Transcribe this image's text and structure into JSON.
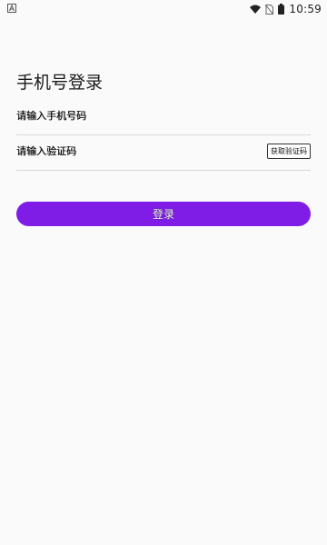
{
  "status_bar": {
    "time": "10:59",
    "icons": [
      "notification-a-icon",
      "wifi-icon",
      "no-sim-icon",
      "battery-icon"
    ]
  },
  "page": {
    "title": "手机号登录"
  },
  "form": {
    "phone_placeholder": "请输入手机号码",
    "phone_value": "",
    "code_placeholder": "请输入验证码",
    "code_value": "",
    "get_code_label": "获取验证码",
    "login_label": "登录"
  },
  "colors": {
    "background": "#fafafa",
    "accent": "#7f1de6",
    "divider": "#d8d8d8"
  }
}
